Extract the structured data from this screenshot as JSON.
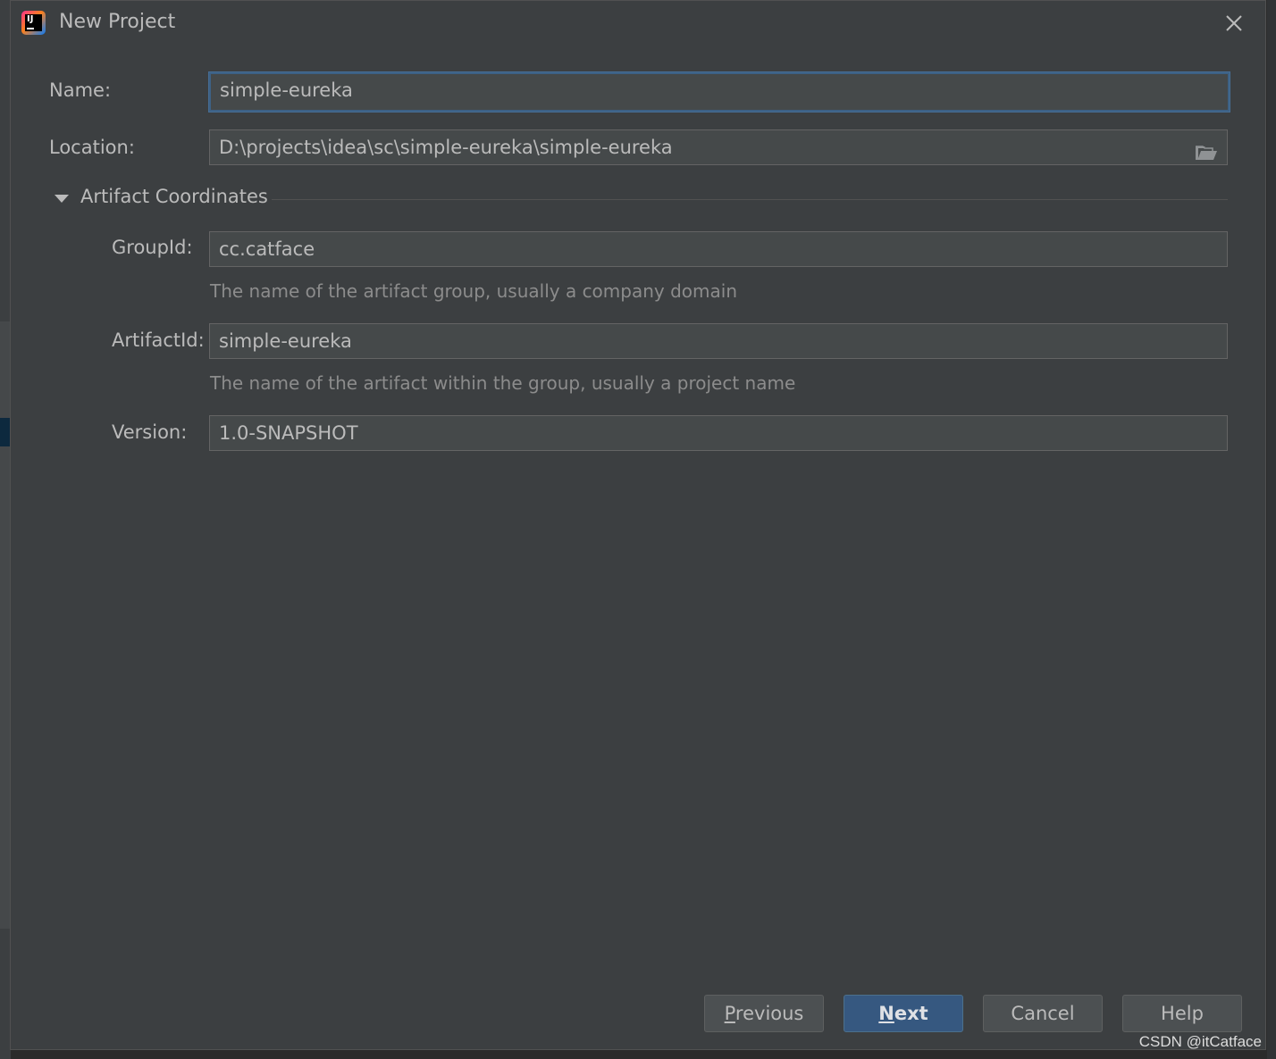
{
  "dialog": {
    "title": "New Project",
    "name_label": "Name:",
    "name_value": "simple-eureka",
    "location_label": "Location:",
    "location_value": "D:\\projects\\idea\\sc\\simple-eureka\\simple-eureka",
    "section_title": "Artifact Coordinates",
    "groupid_label": "GroupId:",
    "groupid_value": "cc.catface",
    "groupid_hint": "The name of the artifact group, usually a company domain",
    "artifactid_label": "ArtifactId:",
    "artifactid_value": "simple-eureka",
    "artifactid_hint": "The name of the artifact within the group, usually a project name",
    "version_label": "Version:",
    "version_value": "1.0-SNAPSHOT"
  },
  "buttons": {
    "previous_mnemonic": "P",
    "previous_rest": "revious",
    "next_mnemonic": "N",
    "next_rest": "ext",
    "cancel": "Cancel",
    "help": "Help"
  },
  "watermark": "CSDN @itCatface",
  "icons": {
    "app": "intellij-idea-icon",
    "close": "close-icon",
    "folder": "folder-open-icon",
    "toggle": "triangle-down-icon"
  },
  "colors": {
    "dialog_bg": "#3c3f41",
    "field_bg": "#45494a",
    "focus_border": "#3d6185",
    "primary_button": "#365880"
  }
}
